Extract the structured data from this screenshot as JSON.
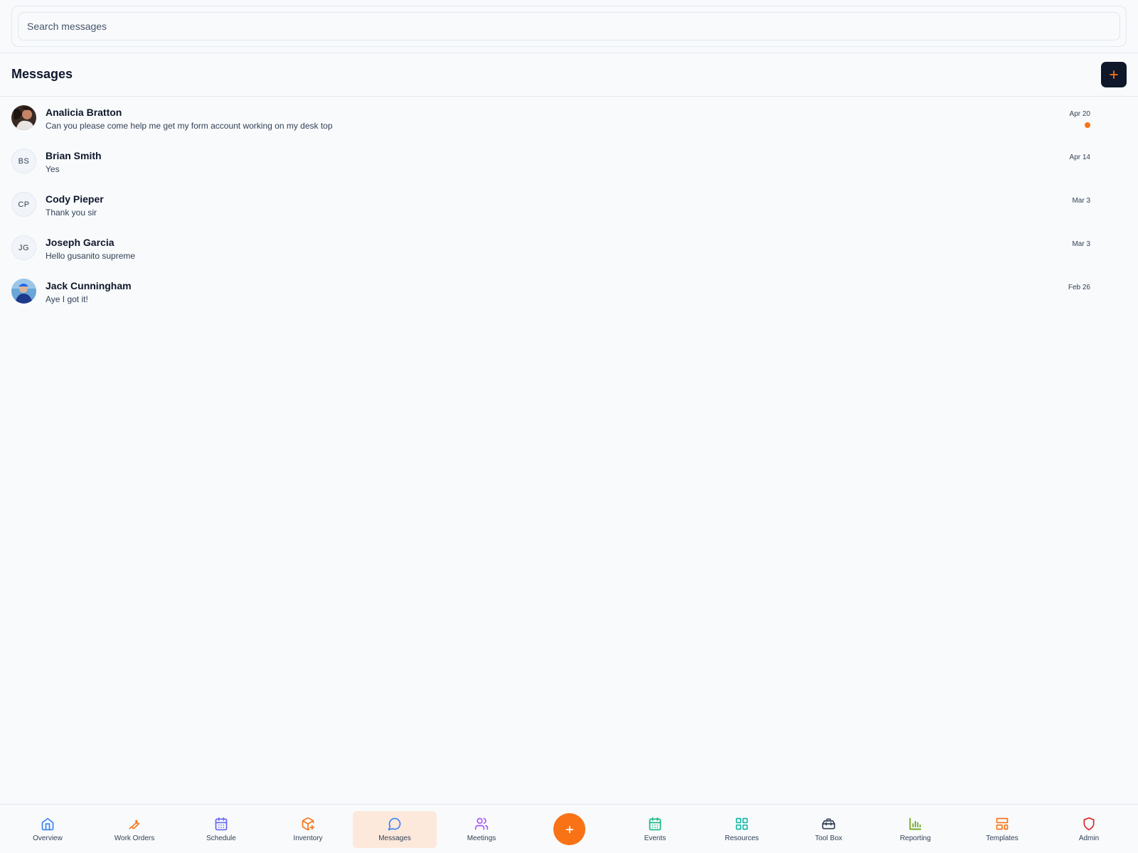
{
  "search": {
    "placeholder": "Search messages",
    "value": ""
  },
  "header": {
    "title": "Messages",
    "new_button_icon": "plus-icon"
  },
  "colors": {
    "accent": "#f97316",
    "dark": "#0f172a",
    "active_tab_bg": "#fde9dc"
  },
  "messages": [
    {
      "name": "Analicia Bratton",
      "preview": "Can you please come help me get my form account working on my desk top",
      "date": "Apr 20",
      "avatar": "photo",
      "unread": true
    },
    {
      "name": "Brian Smith",
      "preview": "Yes",
      "date": "Apr 14",
      "avatar": "BS",
      "unread": false
    },
    {
      "name": "Cody Pieper",
      "preview": "Thank you sir",
      "date": "Mar 3",
      "avatar": "CP",
      "unread": false
    },
    {
      "name": "Joseph Garcia",
      "preview": "Hello gusanito supreme",
      "date": "Mar 3",
      "avatar": "JG",
      "unread": false
    },
    {
      "name": "Jack Cunningham",
      "preview": "Aye I got it!",
      "date": "Feb 26",
      "avatar": "photo",
      "unread": false
    }
  ],
  "nav": {
    "items": [
      {
        "label": "Overview",
        "icon": "home-icon",
        "color": "#3b82f6"
      },
      {
        "label": "Work Orders",
        "icon": "wrench-icon",
        "color": "#f97316"
      },
      {
        "label": "Schedule",
        "icon": "calendar-icon",
        "color": "#6366f1"
      },
      {
        "label": "Inventory",
        "icon": "package-plus-icon",
        "color": "#f97316"
      },
      {
        "label": "Messages",
        "icon": "message-circle-icon",
        "color": "#3b82f6",
        "active": true
      },
      {
        "label": "Meetings",
        "icon": "users-icon",
        "color": "#a855f7"
      },
      {
        "label": "Events",
        "icon": "calendar-grid-icon",
        "color": "#10b981"
      },
      {
        "label": "Resources",
        "icon": "grid-icon",
        "color": "#14b8a6"
      },
      {
        "label": "Tool Box",
        "icon": "toolbox-icon",
        "color": "#334155"
      },
      {
        "label": "Reporting",
        "icon": "bar-chart-icon",
        "color": "#65a30d"
      },
      {
        "label": "Templates",
        "icon": "layout-icon",
        "color": "#f97316"
      },
      {
        "label": "Admin",
        "icon": "shield-icon",
        "color": "#dc2626"
      }
    ],
    "fab_icon": "plus-icon"
  }
}
